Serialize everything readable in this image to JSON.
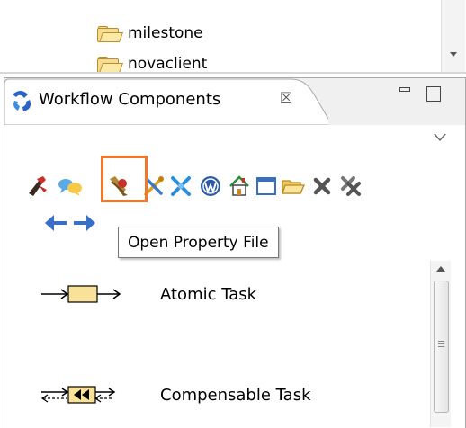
{
  "tree": {
    "items": [
      {
        "label": "milestone",
        "icon": "folder-icon"
      },
      {
        "label": "novaclient",
        "icon": "folder-icon"
      }
    ]
  },
  "view": {
    "title": "Workflow Components",
    "close_glyph": "☒"
  },
  "toolbar": {
    "buttons": [
      {
        "name": "bug-tool-icon"
      },
      {
        "name": "chat-bubbles-icon"
      },
      {
        "name": "open-property-file-icon"
      },
      {
        "name": "tools-icon"
      },
      {
        "name": "run-stop-icon"
      },
      {
        "name": "wordpress-icon"
      },
      {
        "name": "home-icon"
      },
      {
        "name": "window-icon"
      },
      {
        "name": "open-folder-icon"
      },
      {
        "name": "delete-icon"
      },
      {
        "name": "delete-all-icon"
      },
      {
        "name": "back-arrow-icon"
      },
      {
        "name": "forward-arrow-icon"
      }
    ],
    "highlighted": "open-property-file-icon"
  },
  "tooltip": {
    "text": "Open Property File"
  },
  "palette": {
    "items": [
      {
        "label": "Atomic Task",
        "icon": "atomic-task-icon"
      },
      {
        "label": "Compensable Task",
        "icon": "compensable-task-icon"
      }
    ]
  },
  "colors": {
    "highlight": "#f0782a",
    "task_fill": "#f8e29a",
    "folder": "#f6dc90"
  }
}
